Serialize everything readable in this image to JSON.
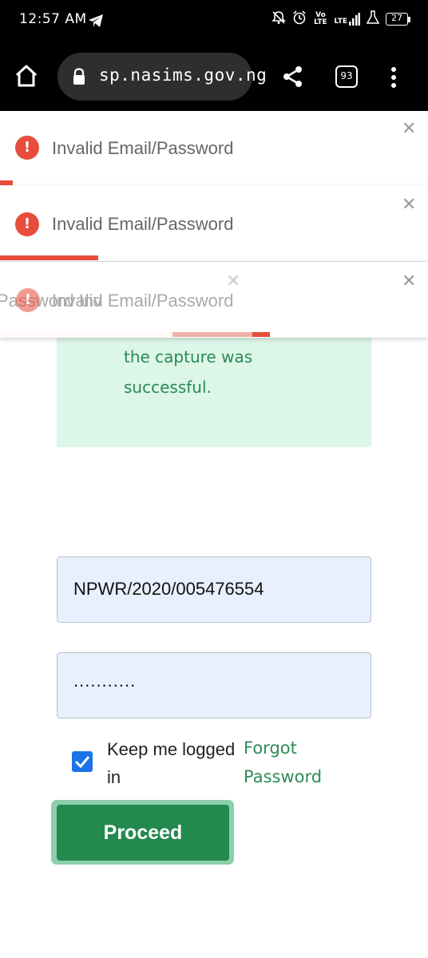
{
  "status_bar": {
    "time": "12:57 AM",
    "network_label": "Vo LTE",
    "network_label2": "LTE",
    "battery": "27",
    "icons": [
      "telegram-icon",
      "mute-icon",
      "alarm-icon",
      "signal-icon",
      "flask-icon",
      "battery-icon"
    ]
  },
  "browser": {
    "url": "sp.nasims.gov.ng",
    "tab_count": "93",
    "icons": [
      "home-icon",
      "lock-icon",
      "share-icon",
      "tabs-icon",
      "menu-icon"
    ]
  },
  "toasts": [
    {
      "message": "Invalid Email/Password",
      "progress": 0.03
    },
    {
      "message": "Invalid Email/Password",
      "progress": 0.23
    },
    {
      "message": "Invalid Email/Password",
      "progress": 0.63
    }
  ],
  "toast_overlay": {
    "message": "Invalid Email/Password",
    "ghost_text": "Password Inv"
  },
  "success_message": "the capture was successful.",
  "login_form": {
    "username_value": "NPWR/2020/005476554",
    "password_value": "...........",
    "keep_logged_in_label": "Keep me logged in",
    "keep_logged_in_checked": true,
    "forgot_password_label": "Forgot Password",
    "proceed_label": "Proceed"
  },
  "colors": {
    "error": "#e74c3c",
    "success_bg": "#dcf6e8",
    "success_text": "#2a8a52",
    "primary_button": "#23894e",
    "checkbox": "#1a73e8",
    "input_bg": "#e8f0fe"
  }
}
